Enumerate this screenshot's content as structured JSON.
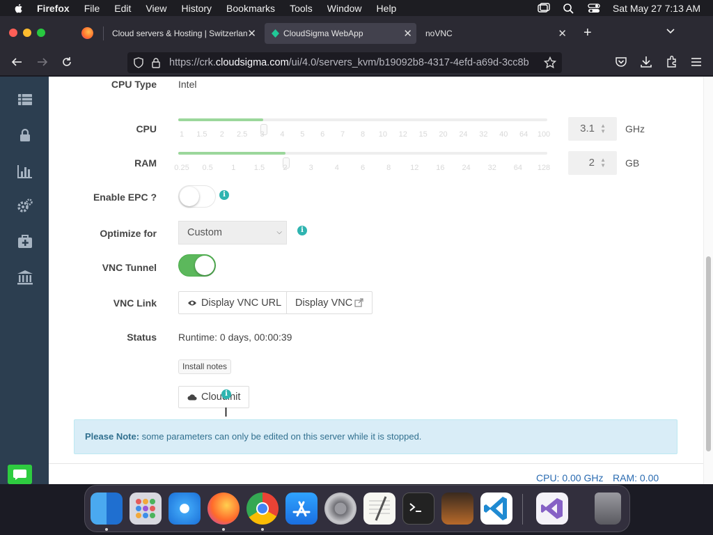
{
  "menubar": {
    "app_name": "Firefox",
    "items": [
      "File",
      "Edit",
      "View",
      "History",
      "Bookmarks",
      "Tools",
      "Window",
      "Help"
    ],
    "clock": "Sat May 27  7:13 AM"
  },
  "tabs": [
    {
      "title": "Cloud servers & Hosting | Switzerlan",
      "active": false
    },
    {
      "title": "CloudSigma WebApp",
      "active": true
    },
    {
      "title": "noVNC",
      "active": false
    }
  ],
  "urlbar": {
    "prefix": "https://crk.",
    "domain": "cloudsigma.com",
    "path": "/ui/4.0/servers_kvm/b19092b8-4317-4efd-a69d-3cc8b"
  },
  "form": {
    "cpu_type": {
      "label": "CPU Type",
      "value": "Intel"
    },
    "cpu": {
      "label": "CPU",
      "value": "3.1",
      "unit": "GHz",
      "fill_fraction": 0.23,
      "ticks": [
        "1",
        "1.5",
        "2",
        "2.5",
        "3",
        "4",
        "5",
        "6",
        "7",
        "8",
        "10",
        "12",
        "15",
        "20",
        "24",
        "32",
        "40",
        "64",
        "100"
      ]
    },
    "ram": {
      "label": "RAM",
      "value": "2",
      "unit": "GB",
      "fill_fraction": 0.29,
      "ticks": [
        "0.25",
        "0.5",
        "1",
        "1.5",
        "2",
        "3",
        "4",
        "6",
        "8",
        "12",
        "16",
        "24",
        "32",
        "64",
        "128"
      ]
    },
    "enable_epc": {
      "label": "Enable EPC ?",
      "on": false
    },
    "optimize_for": {
      "label": "Optimize for",
      "selected": "Custom"
    },
    "vnc_tunnel": {
      "label": "VNC Tunnel",
      "on": true
    },
    "vnc_link": {
      "label": "VNC Link",
      "display_url_button": "Display VNC URL",
      "display_vnc_button": "Display VNC"
    },
    "status": {
      "label": "Status",
      "runtime": "Runtime: 0 days, 00:00:39"
    },
    "install_notes_button": "Install notes",
    "cloudinit_button": "Cloudinit"
  },
  "note": {
    "title": "Please Note:",
    "text": " some parameters can only be edited on this server while it is stopped."
  },
  "footer": {
    "cpu": "CPU: 0.00 GHz",
    "ram": "RAM: 0.00"
  },
  "colors": {
    "sidebar": "#2c3e50",
    "accent_green": "#5cb85c",
    "info": "#2fb4b0",
    "note_bg": "#d9edf7"
  },
  "dock": [
    "finder",
    "launchpad",
    "safari",
    "firefox",
    "chrome",
    "app-store",
    "system-preferences",
    "textedit",
    "terminal",
    "garageband",
    "vscode",
    "visual-studio",
    "trash"
  ]
}
